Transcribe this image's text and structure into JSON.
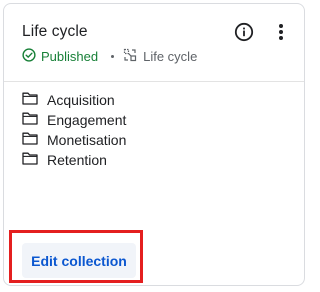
{
  "card": {
    "title": "Life cycle",
    "status": "Published",
    "type_label": "Life cycle",
    "icons": {
      "info": "info-circle-icon",
      "more": "more-vert-icon",
      "status": "check-circle-icon",
      "type": "collection-icon",
      "item": "folder-icon"
    },
    "items": [
      {
        "label": "Acquisition"
      },
      {
        "label": "Engagement"
      },
      {
        "label": "Monetisation"
      },
      {
        "label": "Retention"
      }
    ],
    "edit_label": "Edit collection"
  },
  "colors": {
    "status_green": "#188038",
    "accent_blue": "#0b57d0",
    "highlight_red": "#e41f1f"
  }
}
